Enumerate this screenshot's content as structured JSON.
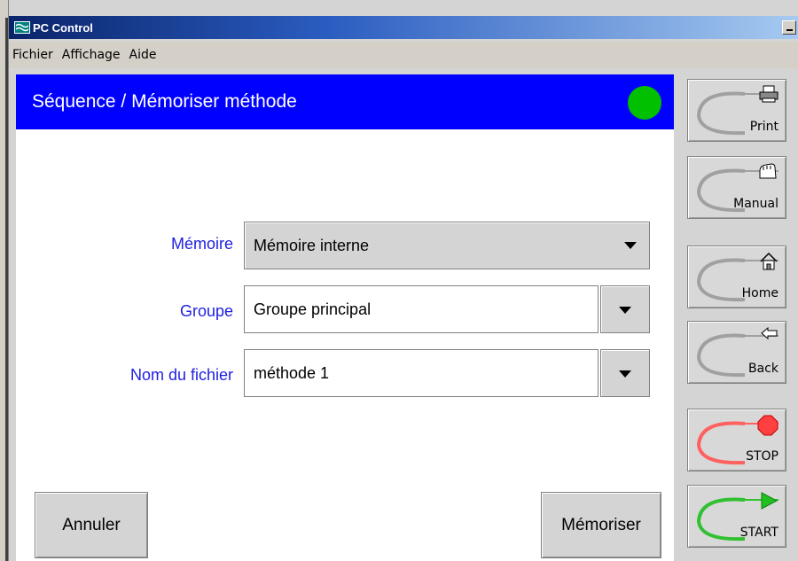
{
  "window": {
    "title": "PC Control"
  },
  "menu": [
    "Fichier",
    "Affichage",
    "Aide"
  ],
  "header": {
    "title": "Séquence / Mémoriser méthode",
    "status_color": "#00c000"
  },
  "form": {
    "memoire": {
      "label": "Mémoire",
      "value": "Mémoire interne"
    },
    "groupe": {
      "label": "Groupe",
      "value": "Groupe principal"
    },
    "fichier": {
      "label": "Nom du fichier",
      "value": "méthode 1"
    }
  },
  "actions": {
    "cancel": "Annuler",
    "save": "Mémoriser"
  },
  "sidebar": {
    "print": "Print",
    "manual": "Manual",
    "home": "Home",
    "back": "Back",
    "stop": "STOP",
    "start": "START"
  },
  "colors": {
    "header_bg": "#0000ff",
    "label": "#2020e0",
    "stop": "#ff4040",
    "start": "#20c020"
  }
}
